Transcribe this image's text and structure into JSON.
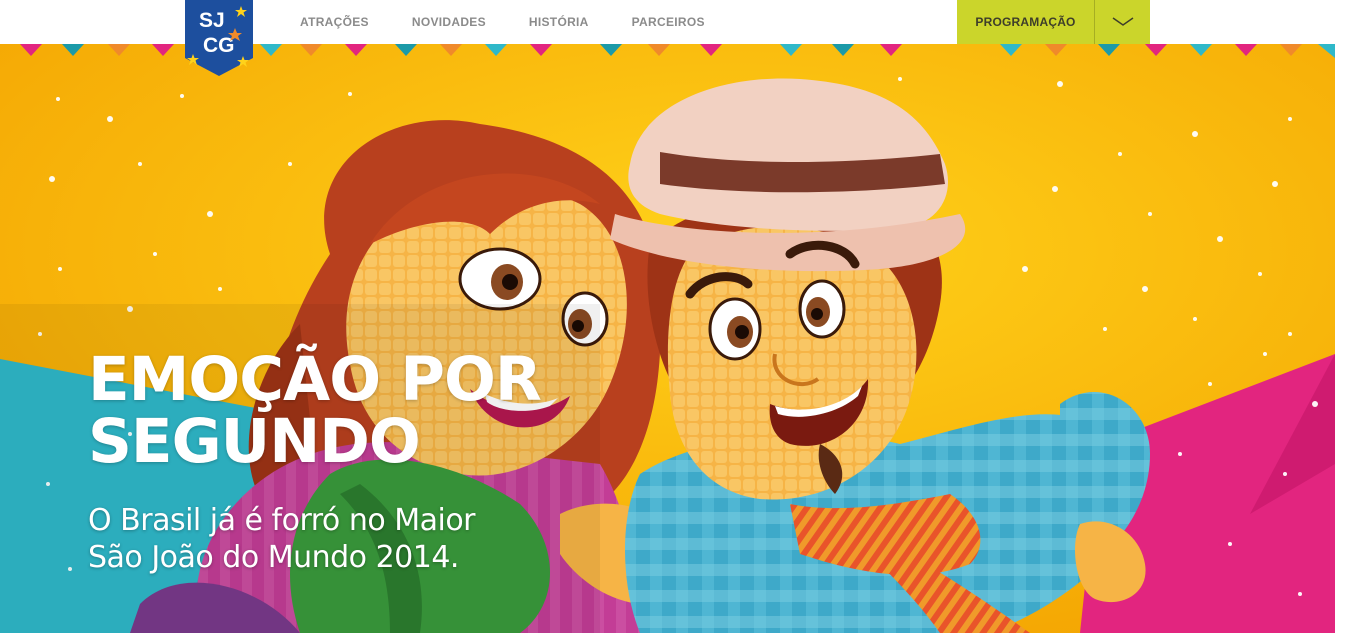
{
  "brand": {
    "logo_text_top": "SJ",
    "logo_text_bottom": "CG"
  },
  "nav": {
    "items": [
      {
        "label": "ATRAÇÕES"
      },
      {
        "label": "NOVIDADES"
      },
      {
        "label": "HISTÓRIA"
      },
      {
        "label": "PARCEIROS"
      }
    ],
    "program_label": "PROGRAMAÇÃO",
    "program_toggle_icon": "chevron-down-icon"
  },
  "hero": {
    "headline_line1": "EMOÇÃO POR",
    "headline_line2": "SEGUNDO",
    "subline_line1": "O Brasil já é forró no Maior",
    "subline_line2": "São João do Mundo 2014.",
    "illustration": "corn-couple-illustration"
  },
  "colors": {
    "accent": "#cbd52b",
    "hero_yellow": "#f7b500",
    "hero_cyan": "#2fb8c9",
    "hero_magenta": "#e2257f",
    "logo_blue": "#1d4f9e",
    "nav_text": "#8b8b8b"
  }
}
